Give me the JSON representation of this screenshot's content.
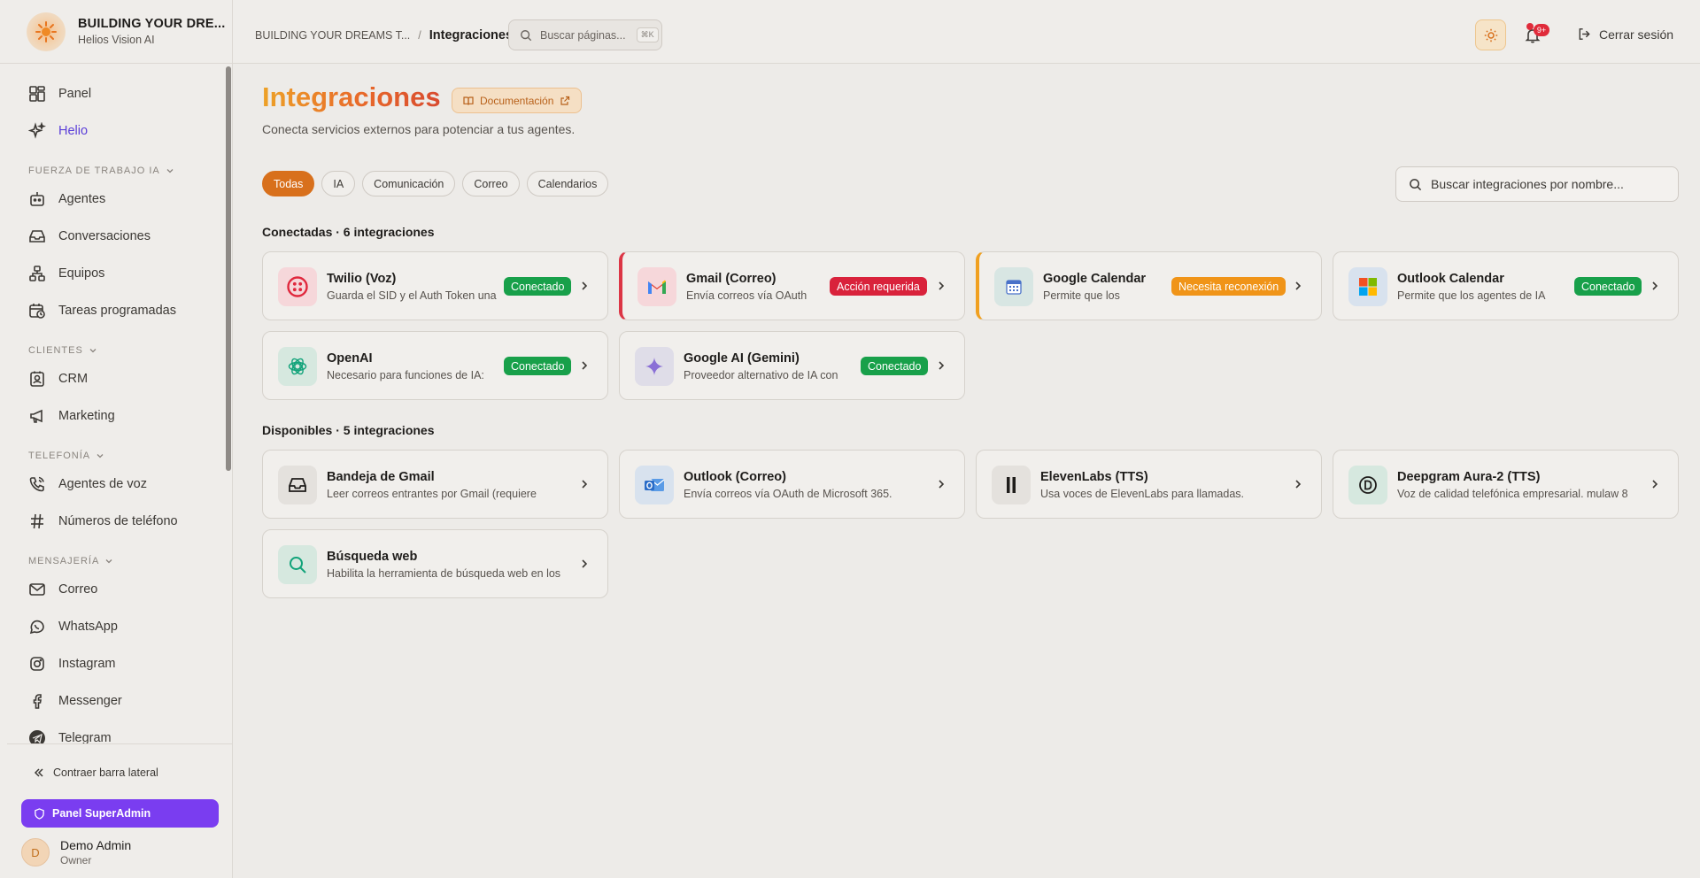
{
  "brand": {
    "title": "BUILDING YOUR DRE...",
    "subtitle": "Helios Vision AI"
  },
  "sidebar": {
    "items": {
      "panel": "Panel",
      "helio": "Helio",
      "agentes": "Agentes",
      "conversaciones": "Conversaciones",
      "equipos": "Equipos",
      "tareas": "Tareas programadas",
      "crm": "CRM",
      "marketing": "Marketing",
      "agentes_voz": "Agentes de voz",
      "numeros": "Números de teléfono",
      "correo": "Correo",
      "whatsapp": "WhatsApp",
      "instagram": "Instagram",
      "messenger": "Messenger",
      "telegram": "Telegram"
    },
    "sections": {
      "fuerza": "FUERZA DE TRABAJO IA",
      "clientes": "CLIENTES",
      "telefonia": "TELEFONÍA",
      "mensajeria": "MENSAJERÍA"
    },
    "collapse_label": "Contraer barra lateral",
    "superadmin_label": "Panel SuperAdmin",
    "user": {
      "initial": "D",
      "name": "Demo Admin",
      "role": "Owner"
    }
  },
  "header": {
    "breadcrumb_root": "BUILDING YOUR DREAMS T...",
    "breadcrumb_sep": "/",
    "breadcrumb_current": "Integraciones",
    "search_placeholder": "Buscar páginas...",
    "search_shortcut": "⌘K",
    "notifications_badge": "9+",
    "logout_label": "Cerrar sesión"
  },
  "main": {
    "title": "Integraciones",
    "doc_label": "Documentación",
    "subtitle": "Conecta servicios externos para potenciar a tus agentes.",
    "filters": [
      "Todas",
      "IA",
      "Comunicación",
      "Correo",
      "Calendarios"
    ],
    "active_filter": "Todas",
    "search_placeholder": "Buscar integraciones por nombre...",
    "connected_title": "Conectadas · 6 integraciones",
    "available_title": "Disponibles · 5 integraciones",
    "connected": [
      {
        "name": "Twilio (Voz)",
        "desc": "Guarda el SID y el Auth Token una",
        "status": "Conectado",
        "icon": "twilio-icon"
      },
      {
        "name": "Gmail (Correo)",
        "desc": "Envía correos vía OAuth",
        "status": "Acción requerida",
        "icon": "gmail-icon"
      },
      {
        "name": "Google Calendar",
        "desc": "Permite que los",
        "status": "Necesita reconexión",
        "icon": "google-calendar-icon"
      },
      {
        "name": "Outlook Calendar",
        "desc": "Permite que los agentes de IA",
        "status": "Conectado",
        "icon": "microsoft-icon"
      },
      {
        "name": "OpenAI",
        "desc": "Necesario para funciones de IA:",
        "status": "Conectado",
        "icon": "openai-icon"
      },
      {
        "name": "Google AI (Gemini)",
        "desc": "Proveedor alternativo de IA con",
        "status": "Conectado",
        "icon": "gemini-icon"
      }
    ],
    "available": [
      {
        "name": "Bandeja de Gmail",
        "desc": "Leer correos entrantes por Gmail (requiere",
        "icon": "inbox-icon"
      },
      {
        "name": "Outlook (Correo)",
        "desc": "Envía correos vía OAuth de Microsoft 365.",
        "icon": "outlook-icon"
      },
      {
        "name": "ElevenLabs (TTS)",
        "desc": "Usa voces de ElevenLabs para llamadas.",
        "icon": "elevenlabs-icon"
      },
      {
        "name": "Deepgram Aura-2 (TTS)",
        "desc": "Voz de calidad telefónica empresarial. mulaw 8",
        "icon": "deepgram-icon"
      },
      {
        "name": "Búsqueda web",
        "desc": "Habilita la herramienta de búsqueda web en los",
        "icon": "search-icon"
      }
    ]
  },
  "colors": {
    "accent": "#d8701c",
    "purple": "#7a3df0",
    "connected": "#18a04a",
    "action_required": "#d9223b",
    "reconnect": "#f09418"
  }
}
